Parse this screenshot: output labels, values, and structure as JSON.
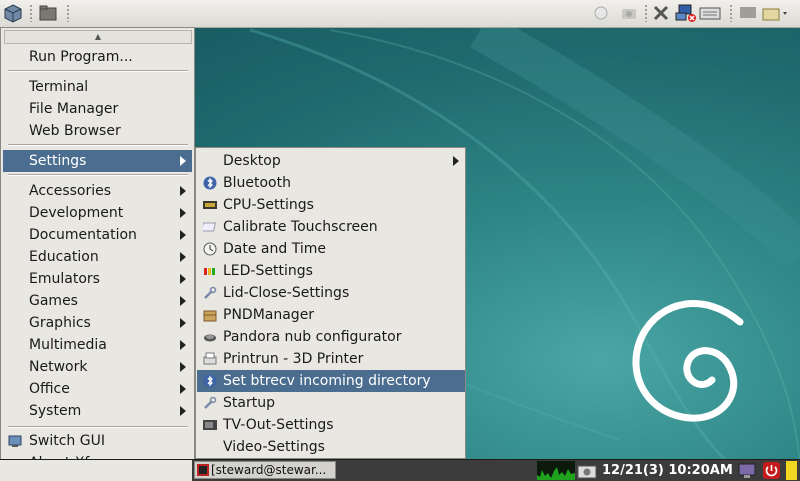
{
  "main_menu": {
    "run_program": "Run Program...",
    "terminal": "Terminal",
    "file_manager": "File Manager",
    "web_browser": "Web Browser",
    "settings": "Settings",
    "categories": [
      "Accessories",
      "Development",
      "Documentation",
      "Education",
      "Emulators",
      "Games",
      "Graphics",
      "Multimedia",
      "Network",
      "Office",
      "System"
    ],
    "switch_gui": "Switch GUI",
    "about_xfce": "About Xfce"
  },
  "settings_menu": {
    "items": [
      {
        "label": "Desktop",
        "icon": "none",
        "submenu": true
      },
      {
        "label": "Bluetooth",
        "icon": "bluetooth-icon"
      },
      {
        "label": "CPU-Settings",
        "icon": "cpu-icon"
      },
      {
        "label": "Calibrate Touchscreen",
        "icon": "touchscreen-icon"
      },
      {
        "label": "Date and Time",
        "icon": "clock-icon"
      },
      {
        "label": "LED-Settings",
        "icon": "led-icon"
      },
      {
        "label": "Lid-Close-Settings",
        "icon": "wrench-icon"
      },
      {
        "label": "PNDManager",
        "icon": "package-icon"
      },
      {
        "label": "Pandora nub configurator",
        "icon": "nub-icon"
      },
      {
        "label": "Printrun - 3D Printer",
        "icon": "printer-icon"
      },
      {
        "label": "Set btrecv incoming directory",
        "icon": "bluetooth-icon",
        "selected": true
      },
      {
        "label": "Startup",
        "icon": "wrench-icon"
      },
      {
        "label": "TV-Out-Settings",
        "icon": "tv-icon"
      },
      {
        "label": "Video-Settings",
        "icon": "none"
      }
    ]
  },
  "taskbar": {
    "task_label": "[steward@stewar...",
    "clock": "12/21(3) 10:20AM"
  },
  "colors": {
    "selection": "#4b6d8f",
    "menu_bg": "#e9e7e2",
    "panel_dark": "#3c3c3c"
  }
}
